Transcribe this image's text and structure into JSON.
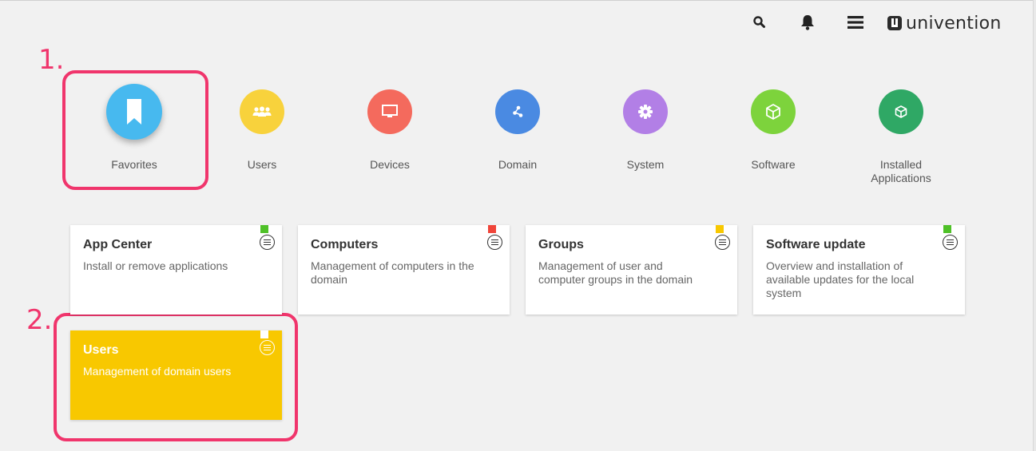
{
  "header": {
    "brand": "univention",
    "icons": [
      "search-icon",
      "bell-icon",
      "menu-icon"
    ]
  },
  "annotations": {
    "first": "1.",
    "second": "2."
  },
  "categories": [
    {
      "label": "Favorites",
      "color": "#47b9ef",
      "icon": "bookmark-icon"
    },
    {
      "label": "Users",
      "color": "#f8d23c",
      "icon": "users-icon"
    },
    {
      "label": "Devices",
      "color": "#f46a5d",
      "icon": "monitor-icon"
    },
    {
      "label": "Domain",
      "color": "#4a8ae2",
      "icon": "network-icon"
    },
    {
      "label": "System",
      "color": "#b27fe6",
      "icon": "gear-icon"
    },
    {
      "label": "Software",
      "color": "#7dd33c",
      "icon": "box-icon"
    },
    {
      "label": "Installed\nApplications",
      "color": "#2fa865",
      "icon": "package-icon"
    }
  ],
  "tiles": [
    {
      "title": "App Center",
      "description": "Install or remove applications",
      "flag_color": "#4fc128"
    },
    {
      "title": "Computers",
      "description": "Management of computers in the domain",
      "flag_color": "#f0453a"
    },
    {
      "title": "Groups",
      "description": "Management of user and computer groups in the domain",
      "flag_color": "#f8c800"
    },
    {
      "title": "Software update",
      "description": "Overview and installation of available updates for the local system",
      "flag_color": "#4fc128"
    },
    {
      "title": "Users",
      "description": "Management of domain users",
      "flag_color": "#ffffff",
      "background": "#f8c800"
    }
  ],
  "colors": {
    "accent_annotation": "#f0356c",
    "page_background": "#f1f1f1"
  }
}
